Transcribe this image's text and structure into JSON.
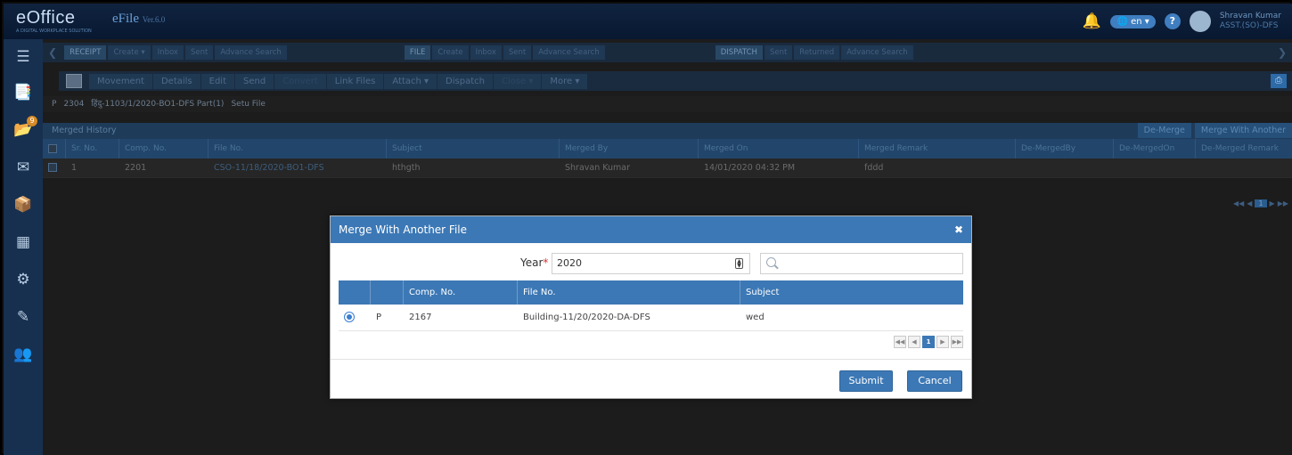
{
  "brand": {
    "logo": "eOffice",
    "logo_sub": "A DIGITAL WORKPLACE SOLUTION",
    "app": "eFile",
    "version": "Ver.6.0"
  },
  "header": {
    "lang": "en",
    "user_name": "Shravan Kumar",
    "user_role": "ASST.(SO)-DFS"
  },
  "menu": {
    "receipt": {
      "title": "RECEIPT",
      "items": [
        "Create",
        "Inbox",
        "Sent",
        "Advance Search"
      ]
    },
    "file": {
      "title": "FILE",
      "items": [
        "Create",
        "Inbox",
        "Sent",
        "Advance Search"
      ]
    },
    "dispatch": {
      "title": "DISPATCH",
      "items": [
        "Sent",
        "Returned",
        "Advance Search"
      ]
    }
  },
  "toolbar": [
    "Movement",
    "Details",
    "Edit",
    "Send",
    "Convert",
    "Link Files",
    "Attach",
    "Dispatch",
    "Close",
    "More"
  ],
  "breadcrumb": {
    "type": "P",
    "comp_no": "2304",
    "file_no": "हिंदु-1103/1/2020-BO1-DFS Part(1)",
    "subject": "Setu File"
  },
  "actions": {
    "demerge": "De-Merge",
    "merge_another": "Merge With Another"
  },
  "merged_history": {
    "title": "Merged History",
    "columns": [
      "Sr. No.",
      "Comp. No.",
      "File No.",
      "Subject",
      "Merged By",
      "Merged On",
      "Merged Remark",
      "De-MergedBy",
      "De-MergedOn",
      "De-Merged Remark"
    ],
    "rows": [
      {
        "sr": "1",
        "comp": "2201",
        "file": "CSO-11/18/2020-BO1-DFS",
        "subject": "hthgth",
        "merged_by": "Shravan Kumar",
        "merged_on": "14/01/2020 04:32 PM",
        "remark": "fddd"
      }
    ],
    "page": "1"
  },
  "modal": {
    "title": "Merge With Another File",
    "year_label": "Year",
    "year_value": "2020",
    "search_value": "",
    "columns": [
      "Comp. No.",
      "File No.",
      "Subject"
    ],
    "rows": [
      {
        "type": "P",
        "comp": "2167",
        "file": "Building-11/20/2020-DA-DFS",
        "subject": "wed"
      }
    ],
    "page": "1",
    "submit": "Submit",
    "cancel": "Cancel"
  },
  "colors": {
    "accent": "#3c78b5",
    "sidebar": "#17304f",
    "required": "#d33333"
  }
}
